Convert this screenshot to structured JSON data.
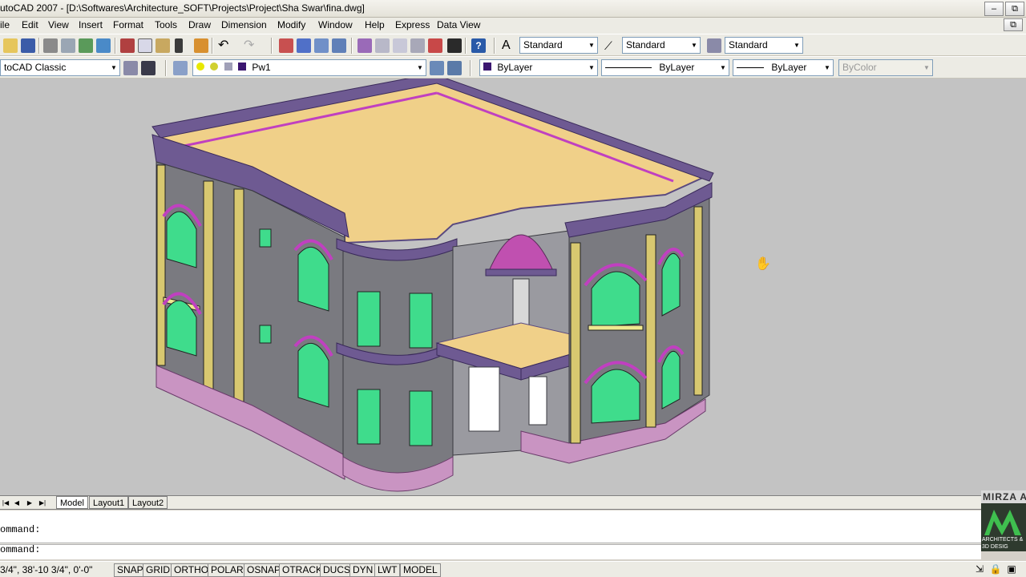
{
  "window": {
    "title": "utoCAD 2007 - [D:\\Softwares\\Architecture_SOFT\\Projects\\Project\\Sha Swar\\fina.dwg]",
    "buttons": {
      "minimize": "–",
      "restore": "❐",
      "close": "✕",
      "doc_restore": "⧉"
    }
  },
  "menu": {
    "items": [
      "ile",
      "Edit",
      "View",
      "Insert",
      "Format",
      "Tools",
      "Draw",
      "Dimension",
      "Modify",
      "Window",
      "Help",
      "Express",
      "Data View"
    ]
  },
  "styles_toolbar": {
    "text_style": "Standard",
    "dim_style": "Standard",
    "table_style": "Standard"
  },
  "workspace": {
    "value": "toCAD Classic"
  },
  "layer": {
    "value": "Pw1",
    "color": "#3b1670"
  },
  "properties": {
    "color": "ByLayer",
    "linetype": "ByLayer",
    "lineweight": "ByLayer",
    "plotstyle": "ByColor"
  },
  "tabs": {
    "items": [
      "Model",
      "Layout1",
      "Layout2"
    ],
    "active": "Model"
  },
  "command": {
    "lines": [
      "ommand:",
      "ommand:"
    ]
  },
  "status": {
    "coords": "3/4\",  38'-10 3/4\", 0'-0\"",
    "buttons": [
      "SNAP",
      "GRID",
      "ORTHO",
      "POLAR",
      "OSNAP",
      "OTRACK",
      "DUCS",
      "DYN",
      "LWT",
      "MODEL"
    ]
  },
  "logo": {
    "name": "MIRZA A",
    "line1": "ARCHITECTS &",
    "line2": "3D DESIG"
  },
  "icons": {
    "cursor": "hand-pan-icon"
  },
  "colors": {
    "wall": "#7a7a80",
    "roof": "#f0d089",
    "trim": "#6e5a92",
    "accent": "#c040c0",
    "glass": "#3fdc8c",
    "base": "#c994c2"
  }
}
